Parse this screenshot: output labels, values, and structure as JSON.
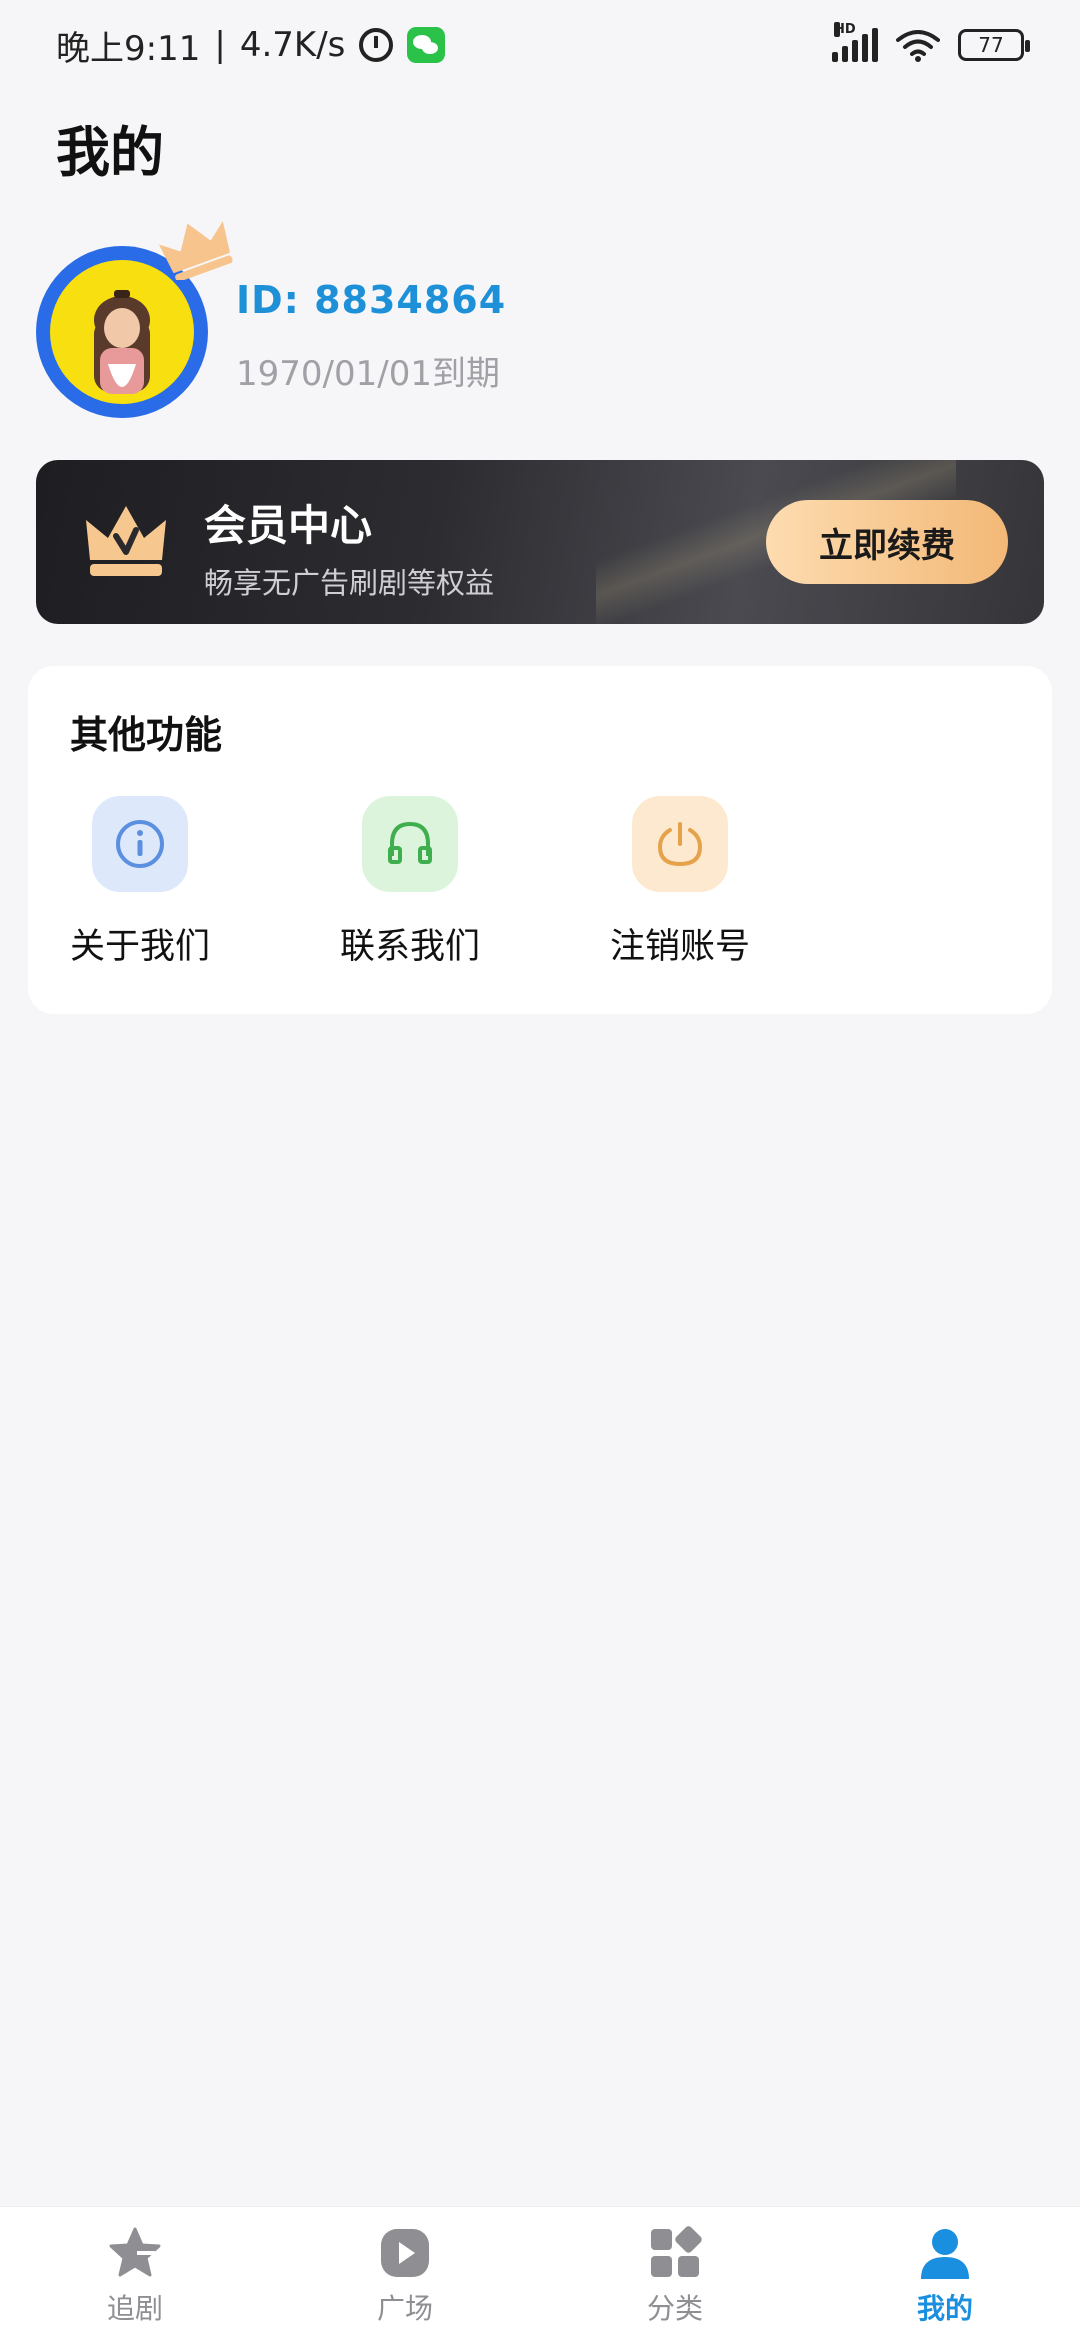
{
  "status_bar": {
    "time": "晚上9:11",
    "separator": "|",
    "speed": "4.7K/s",
    "network": "HD",
    "battery": "77"
  },
  "page": {
    "title": "我的"
  },
  "profile": {
    "id_text": "ID: 8834864",
    "expire_text": "1970/01/01到期"
  },
  "vip": {
    "title": "会员中心",
    "subtitle": "畅享无广告刷剧等权益",
    "button": "立即续费"
  },
  "functions": {
    "title": "其他功能",
    "items": [
      {
        "label": "关于我们",
        "icon": "info-icon",
        "color": "#5b8fe0",
        "bg": "#dde9fb"
      },
      {
        "label": "联系我们",
        "icon": "headset-icon",
        "color": "#3fae4f",
        "bg": "#dcf4dc"
      },
      {
        "label": "注销账号",
        "icon": "power-icon",
        "color": "#e6a24a",
        "bg": "#fde9cf"
      }
    ]
  },
  "nav": {
    "items": [
      {
        "label": "追剧",
        "icon": "star-icon"
      },
      {
        "label": "广场",
        "icon": "play-icon"
      },
      {
        "label": "分类",
        "icon": "category-icon"
      },
      {
        "label": "我的",
        "icon": "user-icon",
        "active": true
      }
    ],
    "active_color": "#1a8fe0",
    "inactive_color": "#8e8e93"
  }
}
